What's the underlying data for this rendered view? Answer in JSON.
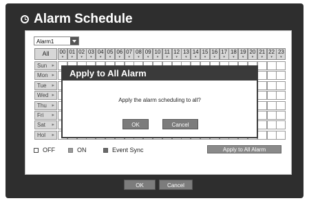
{
  "window": {
    "title": "Alarm Schedule"
  },
  "alarm_select": {
    "value": "Alarm1"
  },
  "grid": {
    "all_label": "All",
    "hours": [
      "00",
      "01",
      "02",
      "03",
      "04",
      "05",
      "06",
      "07",
      "08",
      "09",
      "10",
      "11",
      "12",
      "13",
      "14",
      "15",
      "16",
      "17",
      "18",
      "19",
      "20",
      "21",
      "22",
      "23"
    ],
    "days": [
      "Sun",
      "Mon",
      "Tue",
      "Wed",
      "Thu",
      "Fri",
      "Sat",
      "Hol"
    ]
  },
  "legend": {
    "off": "OFF",
    "on": "ON",
    "event_sync": "Event Sync"
  },
  "apply_all_button": "Apply to All Alarm",
  "footer": {
    "ok": "OK",
    "cancel": "Cancel"
  },
  "dialog": {
    "title": "Apply to All Alarm",
    "message": "Apply the alarm scheduling to all?",
    "ok": "OK",
    "cancel": "Cancel"
  },
  "colors": {
    "frame": "#2e2e2e",
    "on": "#9a9a9a",
    "event_sync": "#6a6a6a",
    "button": "#7c7c7c"
  }
}
